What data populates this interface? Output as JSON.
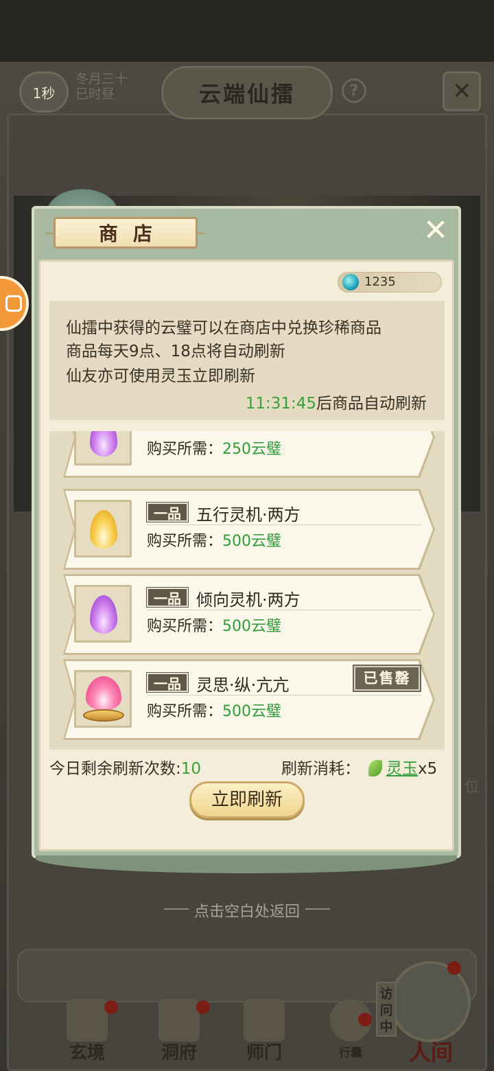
{
  "header": {
    "timer": "1秒",
    "date_line1": "冬月三十",
    "date_line2": "已时昼",
    "title": "云端仙擂",
    "help": "?"
  },
  "shop": {
    "title": "商店",
    "currency_value": "1235",
    "info_lines": [
      "仙擂中获得的云璧可以在商店中兑换珍稀商品",
      "商品每天9点、18点将自动刷新",
      "仙友亦可使用灵玉立即刷新"
    ],
    "refresh_time": "11:31:45",
    "refresh_time_suffix": "后商品自动刷新",
    "cost_label": "购买所需：",
    "items": [
      {
        "grade": "",
        "name": "",
        "cost": "250云璧",
        "icon": "purple-flame-icon",
        "sold_out": false
      },
      {
        "grade": "一品",
        "name": "五行灵机·两方",
        "cost": "500云璧",
        "icon": "gold-flame-icon",
        "sold_out": false
      },
      {
        "grade": "一品",
        "name": "倾向灵机·两方",
        "cost": "500云璧",
        "icon": "purple-flame-icon",
        "sold_out": false
      },
      {
        "grade": "一品",
        "name": "灵思·纵·亢亢",
        "cost": "500云璧",
        "icon": "pink-flame-brazier-icon",
        "sold_out": true,
        "sold_out_label": "已售罄"
      }
    ],
    "refresh_count_label": "今日剩余刷新次数:",
    "refresh_count": "10",
    "refresh_cost_label": "刷新消耗：",
    "refresh_cost_currency": "灵玉",
    "refresh_cost_amount": "x5",
    "refresh_button": "立即刷新"
  },
  "hint": "点击空白处返回",
  "side_text": "位",
  "bottom_nav": {
    "items": [
      "玄境",
      "洞府",
      "师门",
      "行囊"
    ],
    "visit_tag": "访问中",
    "human": "人间"
  }
}
